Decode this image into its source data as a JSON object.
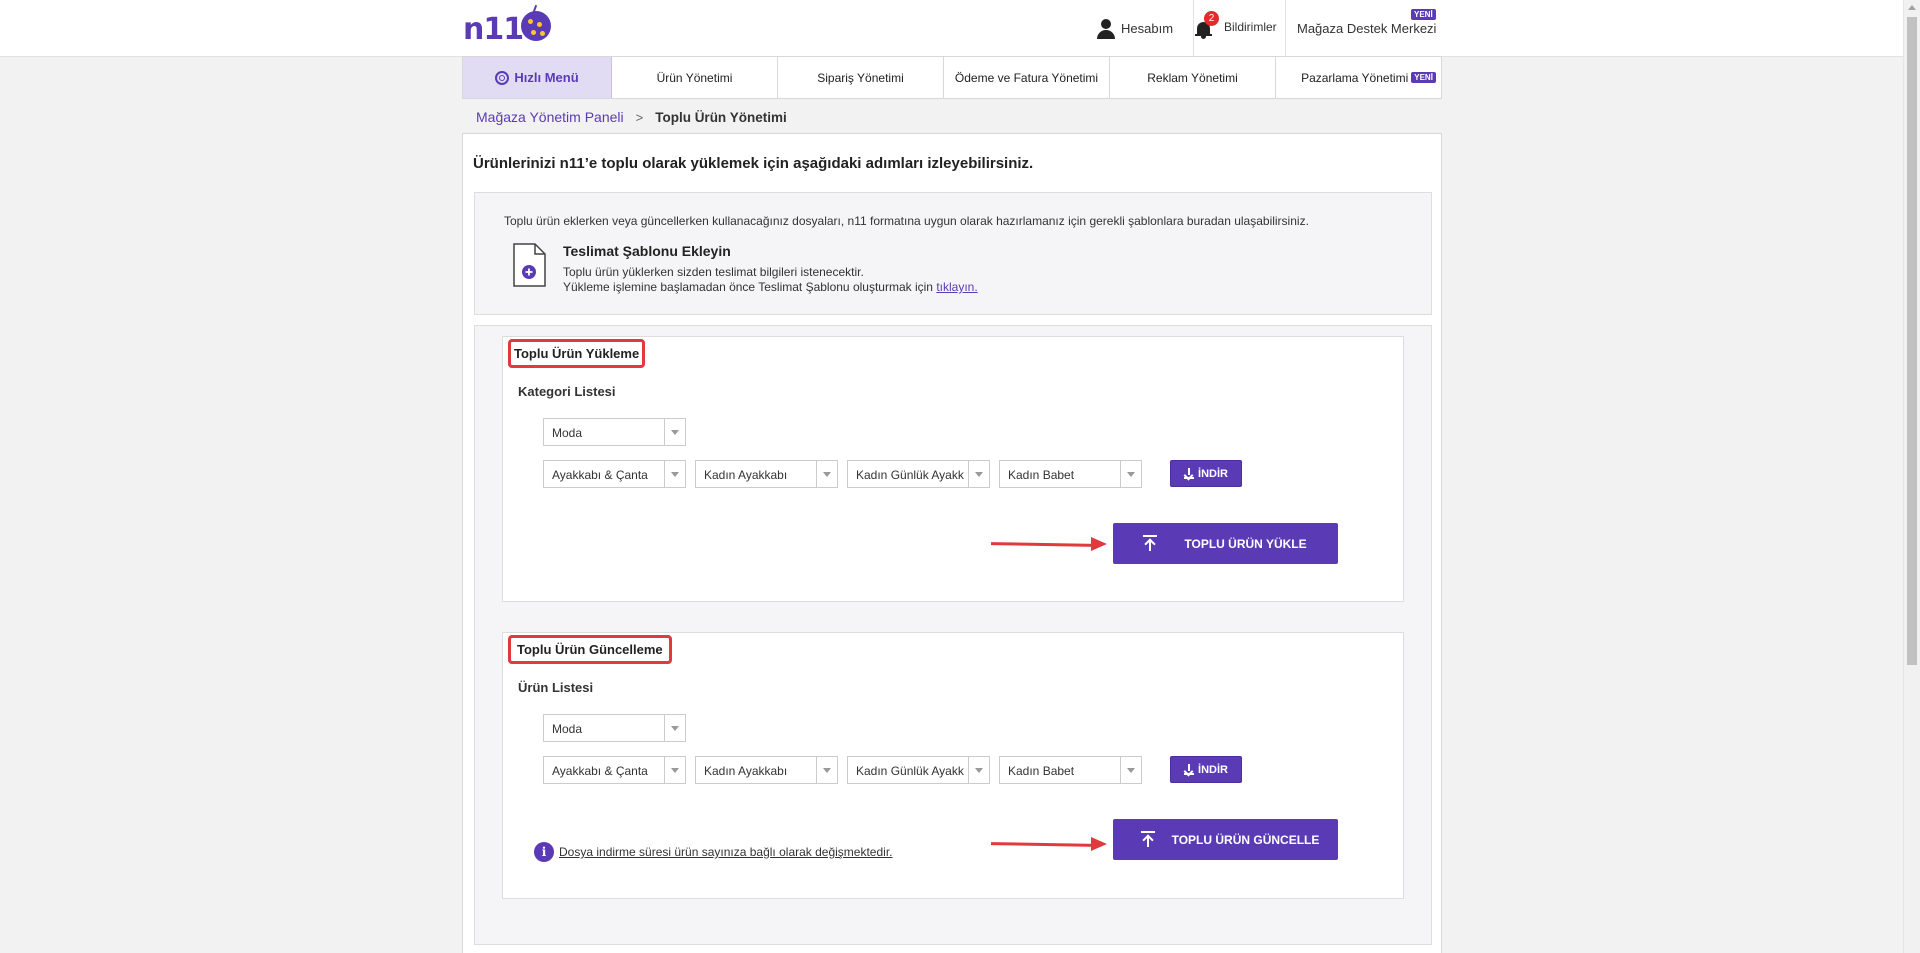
{
  "header": {
    "logo_text": "n11",
    "account_label": "Hesabım",
    "notifications_label": "Bildirimler",
    "notifications_count": "2",
    "support_label": "Mağaza Destek Merkezi",
    "support_badge": "YENİ"
  },
  "nav": {
    "items": [
      {
        "label": "Hızlı Menü"
      },
      {
        "label": "Ürün Yönetimi"
      },
      {
        "label": "Sipariş Yönetimi"
      },
      {
        "label": "Ödeme ve Fatura Yönetimi"
      },
      {
        "label": "Reklam Yönetimi"
      },
      {
        "label": "Pazarlama Yönetimi",
        "badge": "YENİ"
      }
    ]
  },
  "breadcrumb": {
    "parent": "Mağaza Yönetim Paneli",
    "separator": ">",
    "current": "Toplu Ürün Yönetimi"
  },
  "page": {
    "title": "Ürünlerinizi n11’e toplu olarak yüklemek için aşağıdaki adımları izleyebilirsiniz.",
    "info_text": "Toplu ürün eklerken veya güncellerken kullanacağınız dosyaları, n11 formatına uygun olarak hazırlamanız için gerekli şablonlara buradan ulaşabilirsiniz.",
    "template": {
      "title": "Teslimat Şablonu Ekleyin",
      "line1": "Toplu ürün yüklerken sizden teslimat bilgileri istenecektir.",
      "line2": "Yükleme işlemine başlamadan önce Teslimat Şablonu oluşturmak için ",
      "link": "tıklayın."
    }
  },
  "upload_section": {
    "title": "Toplu Ürün Yükleme",
    "subtitle": "Kategori Listesi",
    "dropdown_top": "Moda",
    "dropdowns": [
      "Ayakkabı & Çanta",
      "Kadın Ayakkabı",
      "Kadın Günlük Ayakkabı",
      "Kadın Babet"
    ],
    "download_label": "İNDİR",
    "action_label": "TOPLU ÜRÜN YÜKLE"
  },
  "update_section": {
    "title": "Toplu Ürün Güncelleme",
    "subtitle": "Ürün Listesi",
    "dropdown_top": "Moda",
    "dropdowns": [
      "Ayakkabı & Çanta",
      "Kadın Ayakkabı",
      "Kadın Günlük Ayakkabı",
      "Kadın Babet"
    ],
    "download_label": "İNDİR",
    "action_label": "TOPLU ÜRÜN GÜNCELLE",
    "note": "Dosya indirme süresi ürün sayınıza bağlı olarak değişmektedir.",
    "note_icon": "i"
  },
  "colors": {
    "brand": "#5a3bb5",
    "highlight": "#e0393e",
    "quick_menu_bg": "#e1dbf3"
  }
}
